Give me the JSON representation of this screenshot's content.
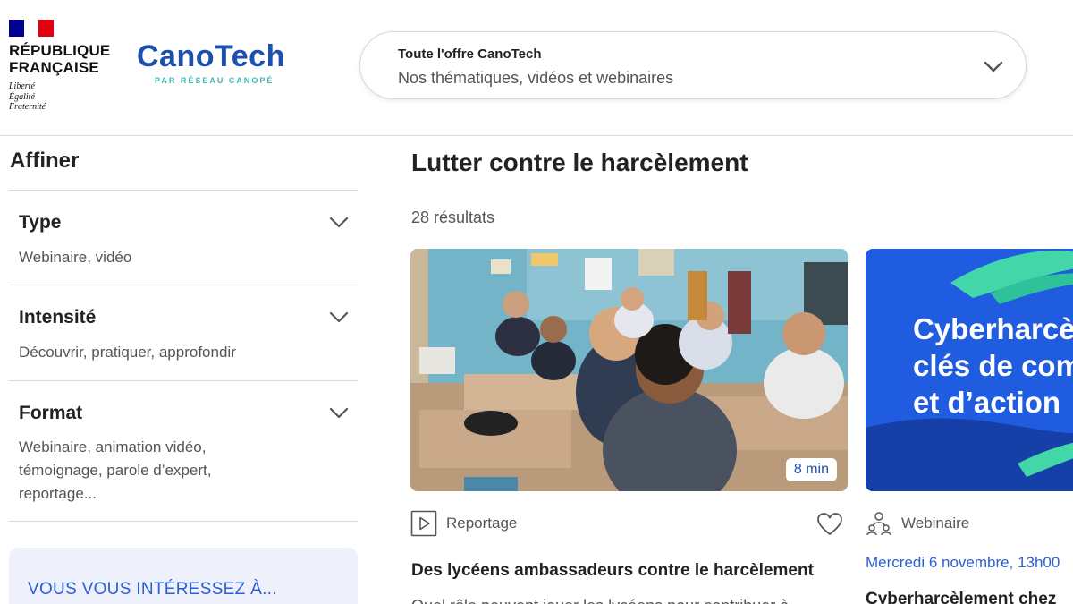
{
  "header": {
    "rf": {
      "name_line1": "RÉPUBLIQUE",
      "name_line2": "FRANÇAISE",
      "motto_line1": "Liberté",
      "motto_line2": "Égalité",
      "motto_line3": "Fraternité"
    },
    "logo": {
      "wordmark": "CanoTech",
      "tagline": "PAR RÉSEAU CANOPÉ"
    },
    "search": {
      "title": "Toute l'offre CanoTech",
      "subtitle": "Nos thématiques, vidéos et webinaires",
      "icon": "chevron-down-icon"
    }
  },
  "sidebar": {
    "heading": "Affiner",
    "filters": [
      {
        "title": "Type",
        "value": "Webinaire, vidéo"
      },
      {
        "title": "Intensité",
        "value": "Découvrir, pratiquer, approfondir"
      },
      {
        "title": "Format",
        "value": "Webinaire,  animation vidéo, témoignage, parole d’expert, reportage..."
      }
    ],
    "promo": {
      "text": "VOUS VOUS INTÉRESSEZ À..."
    }
  },
  "main": {
    "title": "Lutter contre le harcèlement",
    "results": "28 résultats",
    "cards": [
      {
        "duration": "8 min",
        "type_label": "Reportage",
        "type_icon": "play-icon",
        "title": "Des lycéens ambassadeurs contre le harcèlement",
        "description": "Quel rôle peuvent jouer les lycéens pour contribuer à"
      },
      {
        "banner_line1": "Cyberharcè",
        "banner_line2": "clés de com",
        "banner_line3": "et d’action",
        "type_label": "Webinaire",
        "type_icon": "people-icon",
        "date": "Mercredi 6 novembre, 13h00",
        "title": "Cyberharcèlement chez"
      }
    ]
  },
  "colors": {
    "accent": "#2c5fd3",
    "brand_blue": "#1d4fae",
    "brand_teal": "#4fd1b4",
    "banner_bg": "#1f5ce0"
  }
}
